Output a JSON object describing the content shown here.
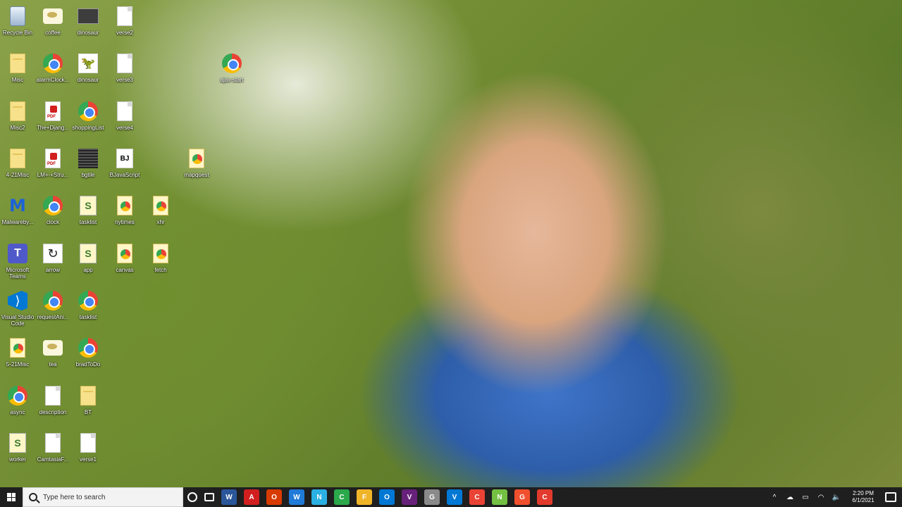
{
  "desktop": {
    "icons": [
      {
        "label": "Recycle Bin",
        "icon": "recycle-bin-icon"
      },
      {
        "label": "coffee",
        "icon": "cup-icon"
      },
      {
        "label": "dinosaur",
        "icon": "dark-image-icon"
      },
      {
        "label": "verse2",
        "icon": "text-document-icon"
      },
      {
        "label": "Misc",
        "icon": "folder-icon"
      },
      {
        "label": "alarmClock...",
        "icon": "chrome-icon"
      },
      {
        "label": "dinosaur",
        "icon": "dinosaur-icon"
      },
      {
        "label": "verse3",
        "icon": "text-document-icon"
      },
      {
        "label": "ajax-start",
        "icon": "chrome-icon"
      },
      {
        "label": "Misc2",
        "icon": "folder-icon"
      },
      {
        "label": "The+Djang...",
        "icon": "pdf-icon"
      },
      {
        "label": "shoppingList",
        "icon": "chrome-icon"
      },
      {
        "label": "verse4",
        "icon": "text-document-icon"
      },
      {
        "label": "4-21Misc",
        "icon": "folder-icon"
      },
      {
        "label": "LM+-+Stru...",
        "icon": "pdf-icon"
      },
      {
        "label": "bgtile",
        "icon": "grid-image-icon"
      },
      {
        "label": "BJavaScript",
        "icon": "blackjack-icon"
      },
      {
        "label": "mapquest",
        "icon": "chrome-folder-icon"
      },
      {
        "label": "Malwareby...",
        "icon": "malwarebytes-icon"
      },
      {
        "label": "clock",
        "icon": "chrome-icon"
      },
      {
        "label": "tasklist",
        "icon": "javascript-file-icon"
      },
      {
        "label": "nytimes",
        "icon": "chrome-folder-icon"
      },
      {
        "label": "xhr",
        "icon": "chrome-folder-icon"
      },
      {
        "label": "Microsoft Teams",
        "icon": "teams-icon"
      },
      {
        "label": "arrow",
        "icon": "arrow-icon"
      },
      {
        "label": "app",
        "icon": "javascript-file-icon"
      },
      {
        "label": "canvas",
        "icon": "chrome-folder-icon"
      },
      {
        "label": "fetch",
        "icon": "chrome-folder-icon"
      },
      {
        "label": "Visual Studio Code",
        "icon": "vscode-icon"
      },
      {
        "label": "requestAni...",
        "icon": "chrome-icon"
      },
      {
        "label": "tasklist",
        "icon": "chrome-icon"
      },
      {
        "label": "5-21Misc",
        "icon": "chrome-folder-icon"
      },
      {
        "label": "tea",
        "icon": "cup-icon"
      },
      {
        "label": "bradToDo",
        "icon": "chrome-icon"
      },
      {
        "label": "async",
        "icon": "chrome-icon"
      },
      {
        "label": "description",
        "icon": "text-document-icon"
      },
      {
        "label": "BT",
        "icon": "folder-icon"
      },
      {
        "label": "worker",
        "icon": "javascript-file-icon"
      },
      {
        "label": "CamtasiaF...",
        "icon": "text-document-icon"
      },
      {
        "label": "verse1",
        "icon": "text-document-icon"
      }
    ]
  },
  "taskbar": {
    "search_placeholder": "Type here to search",
    "pinned": [
      {
        "name": "Word",
        "glyph": "W",
        "color": "#2b579a"
      },
      {
        "name": "Acrobat",
        "glyph": "A",
        "color": "#d11f1f"
      },
      {
        "name": "Office",
        "glyph": "O",
        "color": "#d83b01"
      },
      {
        "name": "WebEx",
        "glyph": "W",
        "color": "#1f7ad8"
      },
      {
        "name": "Notepad",
        "glyph": "N",
        "color": "#2bb0e3"
      },
      {
        "name": "Camtasia",
        "glyph": "C",
        "color": "#2aa84a"
      },
      {
        "name": "File Explorer",
        "glyph": "F",
        "color": "#f0b429"
      },
      {
        "name": "Outlook",
        "glyph": "O",
        "color": "#0078d4"
      },
      {
        "name": "Visual Studio",
        "glyph": "V",
        "color": "#68217a"
      },
      {
        "name": "Gears",
        "glyph": "G",
        "color": "#8a8a8a"
      },
      {
        "name": "VS Code",
        "glyph": "V",
        "color": "#0078d4"
      },
      {
        "name": "Chrome",
        "glyph": "C",
        "color": "#ea4335"
      },
      {
        "name": "Notepad++",
        "glyph": "N",
        "color": "#74c043"
      },
      {
        "name": "Git",
        "glyph": "G",
        "color": "#f1502f"
      },
      {
        "name": "Camtasia Recorder",
        "glyph": "C",
        "color": "#e23b2e"
      }
    ],
    "time": "2:20 PM",
    "date": "6/1/2021"
  }
}
